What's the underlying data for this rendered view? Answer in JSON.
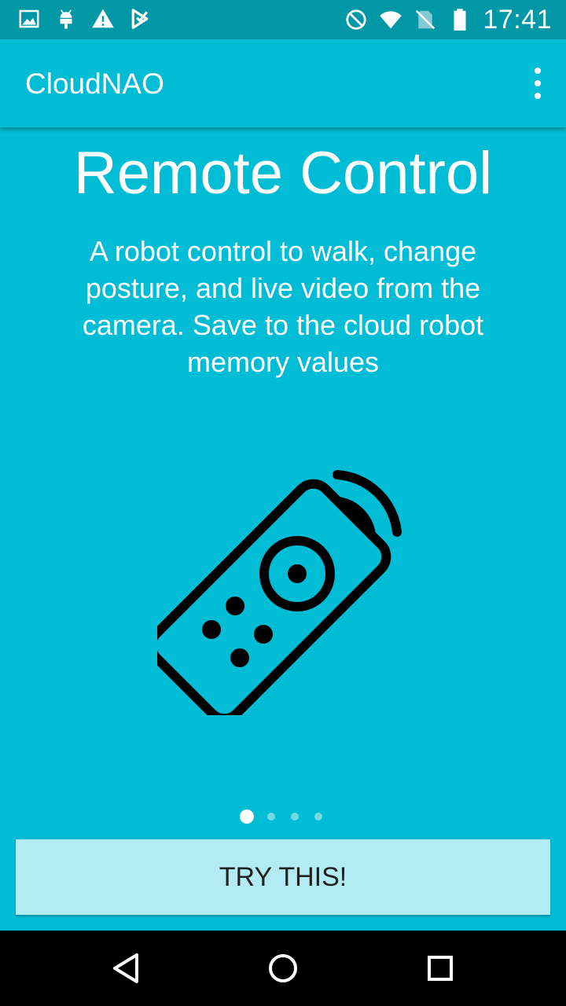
{
  "status_bar": {
    "time": "17:41",
    "left_icons": [
      "gallery-icon",
      "android-debug-icon",
      "warning-icon",
      "play-store-icon"
    ],
    "right_icons": [
      "do-not-disturb-icon",
      "wifi-icon",
      "no-sim-icon",
      "battery-icon"
    ]
  },
  "app_bar": {
    "title": "CloudNAO",
    "menu_icon": "more-vert-icon"
  },
  "onboarding": {
    "title": "Remote Control",
    "description": "A robot control to walk, change posture, and live video from the camera. Save to the cloud robot memory values",
    "illustration_icon": "remote-control-icon",
    "page_count": 4,
    "current_page": 1,
    "cta_label": "TRY THIS!"
  },
  "nav_bar": {
    "buttons": [
      "back-icon",
      "home-icon",
      "recents-icon"
    ]
  },
  "colors": {
    "primary": "#00bcd4",
    "primary_dark": "#0097a7",
    "button_background": "#b2ebf2",
    "text_on_primary": "#ffffff"
  }
}
